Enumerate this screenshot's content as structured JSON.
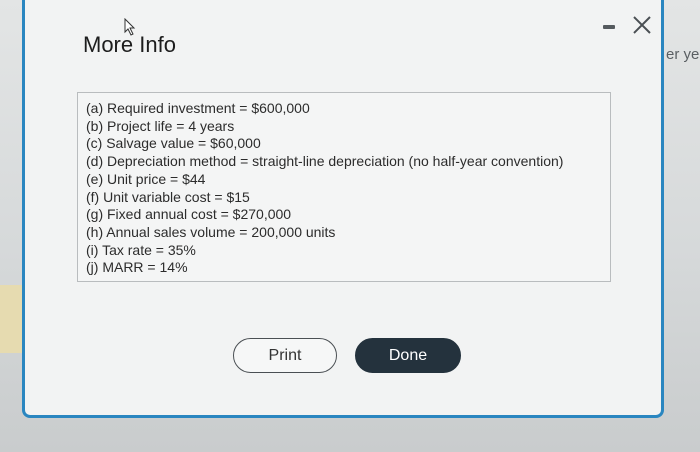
{
  "background": {
    "partial_text": "er ye"
  },
  "dialog": {
    "title": "More Info",
    "minimize_label": "minimize",
    "close_label": "close",
    "items": [
      "(a) Required investment = $600,000",
      "(b) Project life = 4 years",
      "(c) Salvage value = $60,000",
      "(d) Depreciation method = straight-line depreciation (no half-year convention)",
      "(e) Unit price = $44",
      "(f) Unit variable cost = $15",
      "(g) Fixed annual cost = $270,000",
      "(h) Annual sales volume = 200,000 units",
      "(i) Tax rate = 35%",
      "(j) MARR = 14%"
    ],
    "buttons": {
      "print": "Print",
      "done": "Done"
    }
  },
  "colors": {
    "border_accent": "#2a86c0",
    "done_bg": "#24323d",
    "text": "#2c2c2c"
  }
}
